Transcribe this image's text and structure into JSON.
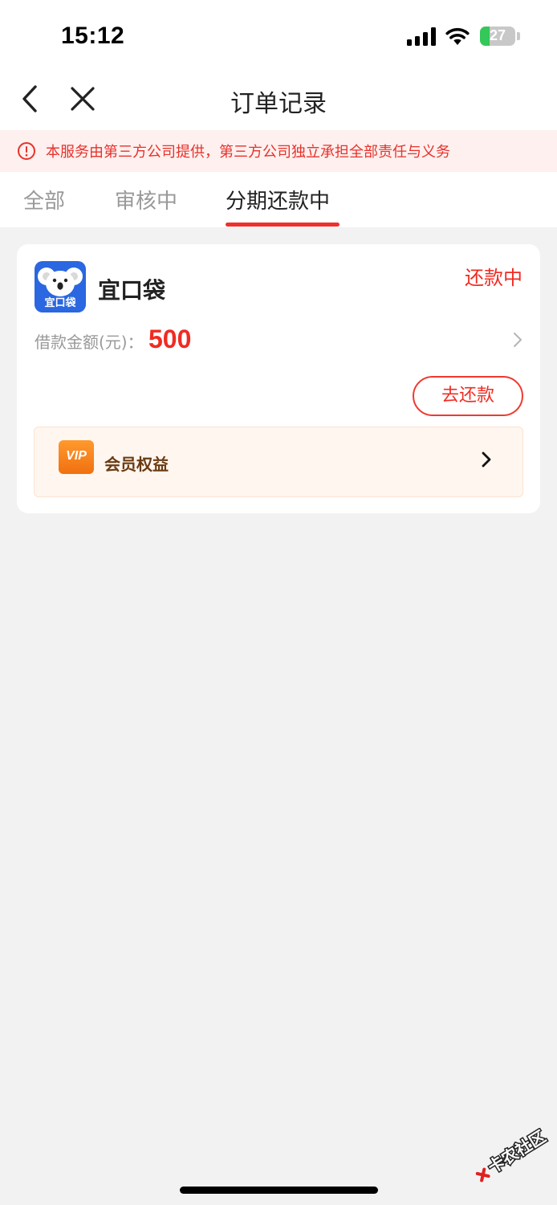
{
  "status_bar": {
    "time": "15:12",
    "battery_level": "27"
  },
  "nav": {
    "title": "订单记录"
  },
  "notice": {
    "text": "本服务由第三方公司提供，第三方公司独立承担全部责任与义务"
  },
  "tabs": [
    {
      "label": "全部",
      "active": false
    },
    {
      "label": "审核中",
      "active": false
    },
    {
      "label": "分期还款中",
      "active": true
    }
  ],
  "order": {
    "app_name": "宜口袋",
    "logo_text": "宜口袋",
    "status": "还款中",
    "amount_label": "借款金额(元)：",
    "amount_value": "500",
    "repay_button": "去还款"
  },
  "vip": {
    "label": "会员权益",
    "icon_text": "VIP"
  },
  "watermark": {
    "text": "卡农社区"
  },
  "colors": {
    "accent": "#f02b22",
    "page_bg": "#f2f2f2",
    "notice_bg": "#fdf0ee",
    "vip_bg": "#fff6ef",
    "logo_blue": "#2a67e0"
  },
  "icons": [
    "back-icon",
    "close-icon",
    "alert-icon",
    "chevron-right-icon",
    "vip-icon",
    "koala-logo"
  ]
}
